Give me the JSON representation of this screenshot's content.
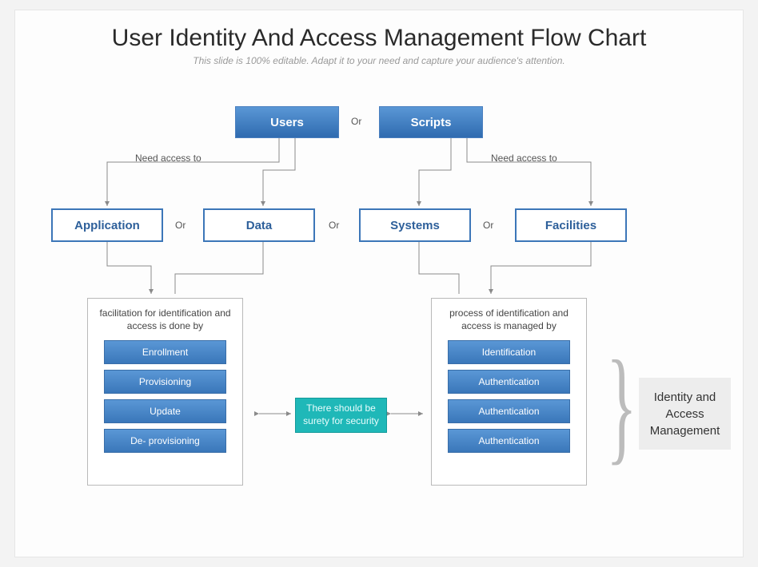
{
  "title": "User Identity And Access Management Flow Chart",
  "subtitle": "This slide is 100% editable. Adapt it to your need and capture your audience's attention.",
  "row1": {
    "users": "Users",
    "or": "Or",
    "scripts": "Scripts"
  },
  "access_left": "Need access to",
  "access_right": "Need access to",
  "row2": {
    "application": "Application",
    "or1": "Or",
    "data": "Data",
    "or2": "Or",
    "systems": "Systems",
    "or3": "Or",
    "facilities": "Facilities"
  },
  "left_panel": {
    "caption": "facilitation for identification and access is done by",
    "items": [
      "Enrollment",
      "Provisioning",
      "Update",
      "De- provisioning"
    ]
  },
  "center_note": "There should be surety for security",
  "right_panel": {
    "caption": "process of identification and access is managed by",
    "items": [
      "Identification",
      "Authentication",
      "Authentication",
      "Authentication"
    ]
  },
  "iam_label": "Identity and Access Management"
}
